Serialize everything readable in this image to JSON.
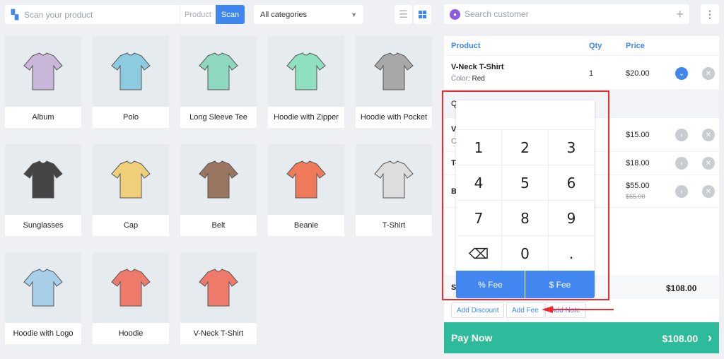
{
  "toolbar": {
    "scan_placeholder": "Scan your product",
    "product_label": "Product",
    "scan_label": "Scan",
    "category": "All categories"
  },
  "products": [
    {
      "name": "Album",
      "color": "#c9b6d8"
    },
    {
      "name": "Polo",
      "color": "#8ccbe0"
    },
    {
      "name": "Long Sleeve Tee",
      "color": "#8fd8c0"
    },
    {
      "name": "Hoodie with Zipper",
      "color": "#8fe0c0"
    },
    {
      "name": "Hoodie with Pocket",
      "color": "#a8a8a8"
    },
    {
      "name": "Sunglasses",
      "color": "#444444"
    },
    {
      "name": "Cap",
      "color": "#f0cf7a"
    },
    {
      "name": "Belt",
      "color": "#9a7560"
    },
    {
      "name": "Beanie",
      "color": "#ee7a5a"
    },
    {
      "name": "T-Shirt",
      "color": "#dddddd"
    },
    {
      "name": "Hoodie with Logo",
      "color": "#a8cfe8"
    },
    {
      "name": "Hoodie",
      "color": "#ee7a6a"
    },
    {
      "name": "V-Neck T-Shirt",
      "color": "#f07a6a"
    }
  ],
  "customer": {
    "placeholder": "Search customer"
  },
  "cart": {
    "headers": {
      "product": "Product",
      "qty": "Qty",
      "price": "Price"
    },
    "item1": {
      "name": "V-Neck T-Shirt",
      "attr_label": "Color",
      "attr_value": "Red",
      "qty": "1",
      "price": "$20.00"
    },
    "qty_row_label": "Q",
    "item2": {
      "name": "V",
      "sub": "C",
      "price": "$15.00"
    },
    "item3": {
      "name": "T-",
      "price": "$18.00"
    },
    "item4": {
      "name": "B",
      "price": "$55.00",
      "original_price": "$65.00"
    },
    "subtotal_label": "S",
    "subtotal": "$108.00"
  },
  "actions": {
    "discount": "Add Discount",
    "fee": "Add Fee",
    "note": "Add Note"
  },
  "pay": {
    "label": "Pay Now",
    "total": "$108.00"
  },
  "numpad": {
    "keys": [
      "1",
      "2",
      "3",
      "4",
      "5",
      "6",
      "7",
      "8",
      "9",
      "⌫",
      "0",
      "."
    ],
    "percent_fee": "% Fee",
    "dollar_fee": "$ Fee"
  },
  "colors": {
    "accent": "#3f86ee",
    "pay": "#2dbb9b",
    "highlight": "#f02a2a"
  }
}
